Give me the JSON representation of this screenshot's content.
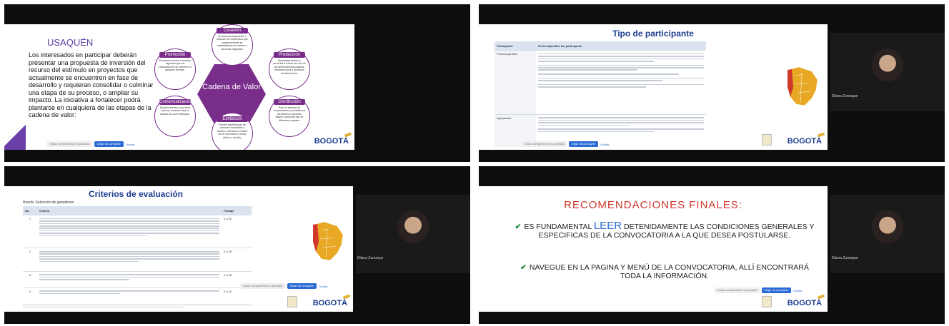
{
  "participant": {
    "name": "Eliana Zumaque"
  },
  "screenshare": {
    "notice": "Estás compartiendo tu pantalla",
    "stop_label": "Dejar de compartir",
    "hide_label": "Ocultar"
  },
  "brand": {
    "logo_text": "BOGOTÁ"
  },
  "slide1": {
    "title": "USAQUÉN",
    "body": "Los interesados en participar deberán presentar una propuesta de inversión del recurso del estímulo en proyectos que actualmente se encuentren en fase de desarrollo y requieran consolidar o culminar una etapa de su proceso, o ampliar su impacto. La iniciativa a fortalecer podrá plantarse en cualquiera de las etapas de la cadena de valor:",
    "center": "Cadena de Valor",
    "nodes": [
      {
        "title": "Creación",
        "desc": "Involucra la inspiración o ideación de contenidos que posteriormente se materializarán en bienes o servicios originales."
      },
      {
        "title": "Producción",
        "desc": "Materializa bienes o servicios a través del uso de herramientas tecnológicas, infraestructura o procesos de fabricación."
      },
      {
        "title": "Distribución",
        "desc": "Pone al alcance de consumidores y exhibidores los bienes o servicios finales, haciendo uso de diferentes canales."
      },
      {
        "title": "Exhibición",
        "desc": "Provee experiencias de consumo asociadas a bienes o servicios a través de un escenario o medio (físico o virtual)."
      },
      {
        "title": "Comercialización",
        "desc": "Dispone bienes y servicios para su consumo final a cambio de una retribución."
      },
      {
        "title": "Promoción",
        "desc": "Posiciona un bien o servicio logrando que los consumidores se interesen o apropien de este."
      }
    ]
  },
  "slide2": {
    "title": "Tipo de participante",
    "col_participant": "Participante",
    "col_profile": "Perfil específico del participante",
    "rows": [
      {
        "label": "Persona jurídica"
      },
      {
        "label": "Agrupación"
      }
    ]
  },
  "slide3": {
    "title": "Criterios de evaluación",
    "subtitle": "Ronda: Selección de ganadores",
    "col_no": "No.",
    "col_criteria": "Criterio",
    "col_score": "Puntaje",
    "rows": [
      {
        "no": "1",
        "score": "0 a 30"
      },
      {
        "no": "2",
        "score": "0 a 25"
      },
      {
        "no": "3",
        "score": "0 a 25"
      },
      {
        "no": "4",
        "score": "0 a 20"
      }
    ]
  },
  "slide4": {
    "title": "RECOMENDACIONES FINALES:",
    "item1_pre": "Es fundamental",
    "item1_big": "LEER",
    "item1_post": "detenidamente las condiciones generales y especificas de la convocatoria a la que desea postularse.",
    "item2": "Navegue en la pagina y menú de la convocatoria, allí encontrará toda la información."
  },
  "colors": {
    "purple": "#7a2e8c",
    "navy": "#1c3d8f",
    "red": "#d0382b",
    "green": "#1f8a3b",
    "map_yellow": "#e8a823",
    "map_red": "#d0382b"
  }
}
